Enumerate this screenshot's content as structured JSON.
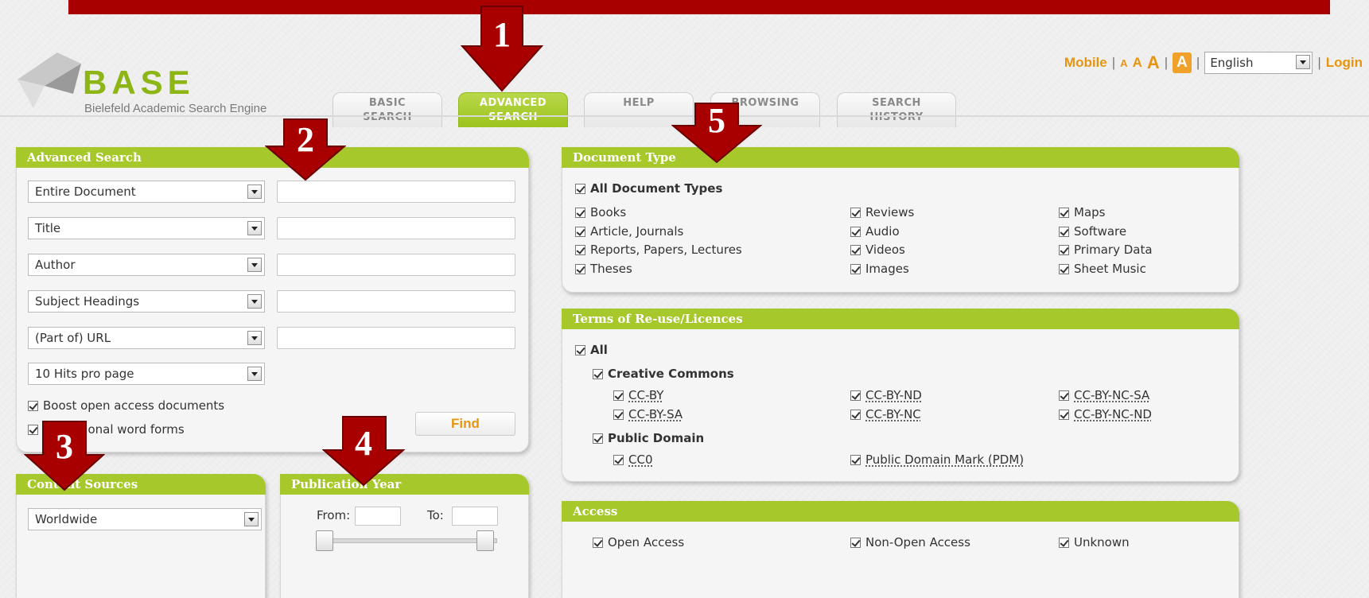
{
  "header": {
    "logo_text": "BASE",
    "logo_sub": "Bielefeld Academic Search Engine",
    "tabs": [
      {
        "line1": "BASIC",
        "line2": "SEARCH"
      },
      {
        "line1": "ADVANCED",
        "line2": "SEARCH"
      },
      {
        "line1": "HELP",
        "line2": ""
      },
      {
        "line1": "BROWSING",
        "line2": ""
      },
      {
        "line1": "SEARCH",
        "line2": "HISTORY"
      }
    ],
    "active_tab": "ADVANCED SEARCH",
    "mobile": "Mobile",
    "sep": "|",
    "font_a": "A",
    "language": "English",
    "login": "Login"
  },
  "advanced_search": {
    "title": "Advanced Search",
    "fields": [
      "Entire Document",
      "Title",
      "Author",
      "Subject Headings",
      "(Part of) URL"
    ],
    "hits": "10 Hits pro page",
    "boost": "Boost open access documents",
    "word_forms": "additional word forms",
    "find": "Find"
  },
  "content_sources": {
    "title": "Content Sources",
    "value": "Worldwide"
  },
  "publication_year": {
    "title": "Publication Year",
    "from": "From:",
    "to": "To:"
  },
  "document_type": {
    "title": "Document Type",
    "all": "All Document Types",
    "col1": [
      "Books",
      "Article, Journals",
      "Reports, Papers, Lectures",
      "Theses"
    ],
    "col2": [
      "Reviews",
      "Audio",
      "Videos",
      "Images"
    ],
    "col3": [
      "Maps",
      "Software",
      "Primary Data",
      "Sheet Music"
    ]
  },
  "licences": {
    "title": "Terms of Re-use/Licences",
    "all": "All",
    "cc": "Creative Commons",
    "cc_items": [
      "CC-BY",
      "CC-BY-SA",
      "CC-BY-ND",
      "CC-BY-NC",
      "CC-BY-NC-SA",
      "CC-BY-NC-ND"
    ],
    "pd": "Public Domain",
    "pd_items": [
      "CC0",
      "Public Domain Mark (PDM)"
    ]
  },
  "access": {
    "title": "Access",
    "items": [
      "Open Access",
      "Non-Open Access",
      "Unknown"
    ]
  },
  "annotations": [
    "1",
    "2",
    "3",
    "4",
    "5"
  ],
  "colors": {
    "accent": "#a6c82b",
    "arrow": "#a80000",
    "orange": "#e79510"
  }
}
